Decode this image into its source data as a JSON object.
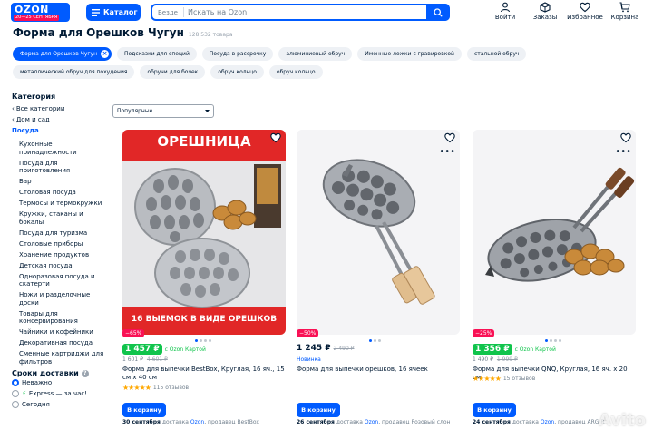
{
  "header": {
    "logo": "OZON",
    "sale_badge": "20—25 СЕНТЯБРЯ",
    "catalog_label": "Каталог",
    "search_scope": "Везде",
    "search_placeholder": "Искать на Ozon",
    "nav": [
      {
        "label": "Войти",
        "icon": "user-icon"
      },
      {
        "label": "Заказы",
        "icon": "box-icon"
      },
      {
        "label": "Избранное",
        "icon": "heart-icon"
      },
      {
        "label": "Корзина",
        "icon": "cart-icon"
      }
    ]
  },
  "page": {
    "title": "Форма для Орешков Чугун",
    "count": "128 532 товара"
  },
  "chips": [
    "Форма для Орешков Чугун",
    "Подсказки для специй",
    "Посуда в рассрочку",
    "алюминиевый обруч",
    "Именные ложки с гравировкой",
    "стальной обруч",
    "металлический обруч для похудения",
    "обручи для бочек",
    "обруч кольцо",
    "обруч кольцо"
  ],
  "sidebar": {
    "category_heading": "Категория",
    "back_links": [
      "Все категории",
      "Дом и сад"
    ],
    "current": "Посуда",
    "items": [
      "Кухонные принадлежности",
      "Посуда для приготовления",
      "Бар",
      "Столовая посуда",
      "Термосы и термокружки",
      "Кружки, стаканы и бокалы",
      "Посуда для туризма",
      "Столовые приборы",
      "Хранение продуктов",
      "Детская посуда",
      "Одноразовая посуда и скатерти",
      "Ножи и разделочные доски",
      "Товары для консервирования",
      "Чайники и кофейники",
      "Декоративная посуда",
      "Сменные картриджи для фильтров"
    ],
    "delivery_heading": "Сроки доставки",
    "delivery_options": [
      "Неважно",
      "Express — за час!",
      "Сегодня"
    ],
    "express_mark": "⚡"
  },
  "sort": {
    "selected": "Популярные"
  },
  "products": [
    {
      "banner_title": "ОРЕШНИЦА",
      "banner_bottom": "16 ВЫЕМОК В ВИДЕ ОРЕШКОВ",
      "discount": "−65%",
      "price": "1 457 ₽",
      "price_style": "card",
      "card_label": "с Ozon Картой",
      "old_price": "",
      "reg_price": "1 601 ₽",
      "reg_old_price": "4 601 ₽",
      "novelty": "",
      "name": "Форма для выпечки BestBox, Круглая, 16 яч., 15 см х 40 см",
      "stars": "★★★★★",
      "reviews": "115 отзывов",
      "cart": "В корзину",
      "delivery_date": "30 сентября",
      "delivery_text": "доставка",
      "delivery_brand": "Ozon",
      "seller": ", продавец BestBox"
    },
    {
      "banner_title": "",
      "banner_bottom": "",
      "discount": "−50%",
      "price": "1 245 ₽",
      "price_style": "plain",
      "card_label": "",
      "old_price": "2 490 ₽",
      "reg_price": "",
      "reg_old_price": "",
      "novelty": "Новинка",
      "name": "Форма для выпечки орешков, 16 ячеек",
      "stars": "",
      "reviews": "",
      "cart": "В корзину",
      "delivery_date": "26 сентября",
      "delivery_text": "доставка",
      "delivery_brand": "Ozon",
      "seller": ", продавец Розовый слон"
    },
    {
      "banner_title": "",
      "banner_bottom": "",
      "discount": "−25%",
      "price": "1 356 ₽",
      "price_style": "card",
      "card_label": "с Ozon Картой",
      "old_price": "",
      "reg_price": "1 490 ₽",
      "reg_old_price": "1 999 ₽",
      "novelty": "",
      "name": "Форма для выпечки QNQ, Круглая, 16 яч. х 20 см",
      "stars": "★★★★★",
      "reviews": "15 отзывов",
      "cart": "В корзину",
      "delivery_date": "24 сентября",
      "delivery_text": "доставка",
      "delivery_brand": "Ozon",
      "seller": ", продавец ARG R"
    }
  ],
  "watermark": "Avito",
  "colors": {
    "brand": "#005bff",
    "discount": "#f91155",
    "card_price": "#10c44c",
    "chip_bg": "#eef1f5"
  }
}
